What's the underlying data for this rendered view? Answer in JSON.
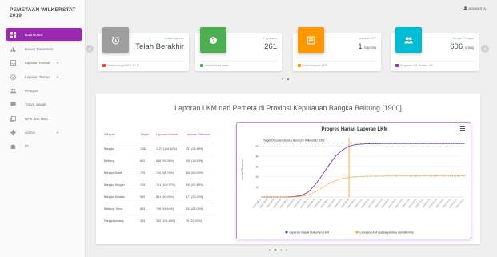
{
  "brand": "PEMETAAN WILKERSTAT 2019",
  "user": {
    "label": "ADMINISTA"
  },
  "sidebar": {
    "items": [
      {
        "label": "Dashboard",
        "icon": "dashboard-icon",
        "active": true
      },
      {
        "label": "Rekap Pemetaan",
        "icon": "bar-chart-icon"
      },
      {
        "label": "Laporan Masuk",
        "icon": "inbox-icon",
        "chevron": "▼"
      },
      {
        "label": "Laporan Terima",
        "icon": "check-circle-icon",
        "chevron": "▼"
      },
      {
        "label": "Petugas",
        "icon": "people-icon"
      },
      {
        "label": "Tanya Jawab",
        "icon": "chat-icon"
      },
      {
        "label": "NPS dan NBS",
        "icon": "library-icon"
      },
      {
        "label": "Admin",
        "icon": "settings-icon",
        "chevron": "▼"
      },
      {
        "label": "Dl",
        "icon": "extension-icon"
      }
    ]
  },
  "cards": [
    {
      "caption": "Batas Laporan",
      "value": "Telah Berakhir",
      "unit": "",
      "footer": "Berakhir tanggal 2019-10-12",
      "color": "#9e9e9e",
      "foot_color": "#f44336",
      "icon": "clock-icon"
    },
    {
      "caption": "Pemetaan",
      "value": "261",
      "unit": "",
      "footer": "Lihat full tanya jawab...",
      "color": "#4caf50",
      "foot_color": "#4caf50",
      "icon": "help-icon"
    },
    {
      "caption": "Laporan LKP",
      "value": "1",
      "unit": "laporan",
      "footer": "Lihat full laporan LKP...",
      "color": "#ff9800",
      "foot_color": "#ff9800",
      "icon": "note-icon"
    },
    {
      "caption": "Jumlah Petugas",
      "value": "606",
      "unit": "orang",
      "footer": "Pengawas: 115, Pemeta: 491",
      "color": "#00bcd4",
      "foot_color": "#9c27b0",
      "icon": "group-icon"
    }
  ],
  "panel": {
    "title": "Laporan LKM dari Pemeta di Provinsi Kepulauan Bangka Belitung [1900]",
    "columns": [
      "Wilayah",
      "Target",
      "Laporan Masuk",
      "Laporan Diterima"
    ],
    "rows": [
      [
        "Bangka",
        "1082",
        "1127 (104.16%)",
        "251 (24.48%)"
      ],
      [
        "Belitung",
        "642",
        "638 (99.38%)",
        "158 (16.50%)"
      ],
      [
        "Bangka Barat",
        "725",
        "716 (98.76%)",
        "485 (66.90%)"
      ],
      [
        "Bangka Tengah",
        "725",
        "761 (104.97%)",
        "490 (67.49%)"
      ],
      [
        "Bangka Selatan",
        "940",
        "851 (90.54%)",
        "877 (93.30%)"
      ],
      [
        "Belitung Timur",
        "834",
        "796 (95.44%)",
        "534 (64.03%)"
      ],
      [
        "Pangkalpinang",
        "354",
        "360 (101.69%)",
        "79 (22.32%)"
      ]
    ]
  },
  "chart_data": {
    "type": "line",
    "title": "Progres Harian Laporan LKM",
    "ylabel": "Jumlah Dokumen",
    "ylim": [
      0,
      5500
    ],
    "yticks": [
      "5k",
      "4k",
      "3k",
      "2k",
      "1k"
    ],
    "target_label": "Target Dokumen Sensus Bumi (SE Wilkerstat): 5302",
    "target_value": 5302,
    "x": [
      "2019-08-01",
      "2019-08-04",
      "2019-08-07",
      "2019-08-10",
      "2019-08-13",
      "2019-08-16",
      "2019-08-19",
      "2019-08-22",
      "2019-08-25",
      "2019-08-28",
      "2019-08-31",
      "2019-09-03",
      "2019-09-06",
      "2019-09-09",
      "2019-09-12",
      "2019-09-15",
      "2019-09-18",
      "2019-09-21",
      "2019-09-24",
      "2019-09-27",
      "2019-09-30",
      "2019-10-03",
      "2019-10-06",
      "2019-10-09",
      "2019-10-12",
      "2019-10-15",
      "2019-10-18",
      "2019-10-21",
      "2019-10-24",
      "2019-10-27",
      "2019-10-30"
    ],
    "series": [
      {
        "name": "Laporan masuk Dokumen LKM",
        "color": "#7b3fa0",
        "values": [
          0,
          0,
          0,
          0,
          10,
          40,
          150,
          500,
          1200,
          2100,
          3100,
          4000,
          4600,
          5000,
          5150,
          5200,
          5230,
          5240,
          5248,
          5250,
          5250,
          5250,
          5250,
          5250,
          5250,
          5250,
          5250,
          5250,
          5250,
          5250,
          5250
        ]
      },
      {
        "name": "Laporan LKM selesai periksa dan diterima",
        "color": "#f5a623",
        "values": [
          0,
          0,
          0,
          0,
          0,
          10,
          50,
          200,
          500,
          900,
          1300,
          1600,
          1800,
          1900,
          1980,
          2020,
          2040,
          2050,
          2060,
          2065,
          2070,
          2070,
          2072,
          2072,
          2072,
          2072,
          2072,
          2072,
          2073,
          2073,
          2073
        ]
      }
    ],
    "vline_x": "2019-09-09",
    "menu_icon": "menu-icon"
  },
  "pager_top": {
    "count": 2,
    "active": 1
  },
  "pager_bottom": {
    "count": 4,
    "active": 1
  }
}
